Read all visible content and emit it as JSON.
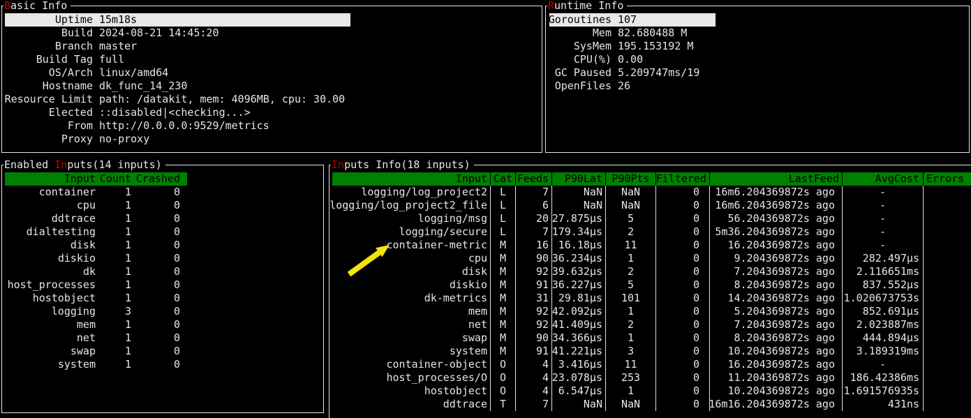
{
  "colors": {
    "background": "#000000",
    "foreground": "#e6e6e6",
    "border": "#e6e6e6",
    "header_green": "#008000",
    "hotkey_red": "#c00000",
    "selection_bg": "#e8e8e8",
    "arrow_yellow": "#f2e40e"
  },
  "panels": {
    "basic_info": {
      "title_segments": [
        {
          "t": "B",
          "red": true
        },
        {
          "t": "asic Info",
          "red": false
        }
      ],
      "rows": [
        {
          "label": "Uptime",
          "value": "15m18s",
          "selected": true
        },
        {
          "label": "Build",
          "value": "2024-08-21 14:45:20"
        },
        {
          "label": "Branch",
          "value": "master"
        },
        {
          "label": "Build Tag",
          "value": "full"
        },
        {
          "label": "OS/Arch",
          "value": "linux/amd64"
        },
        {
          "label": "Hostname",
          "value": "dk_func_14_230"
        },
        {
          "label": "Resource Limit",
          "value": "path: /datakit, mem: 4096MB, cpu: 30.00"
        },
        {
          "label": "Elected",
          "value": "::disabled|<checking...>"
        },
        {
          "label": "From",
          "value": "http://0.0.0.0:9529/metrics"
        },
        {
          "label": "Proxy",
          "value": "no-proxy"
        }
      ]
    },
    "runtime_info": {
      "title_segments": [
        {
          "t": "R",
          "red": true
        },
        {
          "t": "untime Info",
          "red": false
        }
      ],
      "rows": [
        {
          "label": "Goroutines",
          "value": "107",
          "selected": true
        },
        {
          "label": "Mem",
          "value": "82.680488 M"
        },
        {
          "label": "SysMem",
          "value": "195.153192 M"
        },
        {
          "label": "CPU(%)",
          "value": "0.00"
        },
        {
          "label": "GC Paused",
          "value": "5.209747ms/19"
        },
        {
          "label": "OpenFiles",
          "value": "26"
        }
      ]
    },
    "enabled_inputs": {
      "title_segments": [
        {
          "t": "Enabled ",
          "red": false
        },
        {
          "t": "In",
          "red": true
        },
        {
          "t": "puts(14 inputs)",
          "red": false
        }
      ],
      "headers": [
        "Input",
        "Count",
        "Crashed"
      ],
      "rows": [
        [
          "container",
          "1",
          "0"
        ],
        [
          "cpu",
          "1",
          "0"
        ],
        [
          "ddtrace",
          "1",
          "0"
        ],
        [
          "dialtesting",
          "1",
          "0"
        ],
        [
          "disk",
          "1",
          "0"
        ],
        [
          "diskio",
          "1",
          "0"
        ],
        [
          "dk",
          "1",
          "0"
        ],
        [
          "host_processes",
          "1",
          "0"
        ],
        [
          "hostobject",
          "1",
          "0"
        ],
        [
          "logging",
          "3",
          "0"
        ],
        [
          "mem",
          "1",
          "0"
        ],
        [
          "net",
          "1",
          "0"
        ],
        [
          "swap",
          "1",
          "0"
        ],
        [
          "system",
          "1",
          "0"
        ]
      ]
    },
    "inputs_info": {
      "title_segments": [
        {
          "t": "In",
          "red": true
        },
        {
          "t": "puts Info(18 inputs)",
          "red": false
        }
      ],
      "headers": [
        "Input",
        "Cat",
        "Feeds",
        "P90Lat",
        "P90Pts",
        "Filtered",
        "LastFeed",
        "AvgCost",
        "Errors"
      ],
      "rows": [
        [
          "logging/log_project2",
          "L",
          "7",
          "NaN",
          "NaN",
          "0",
          "16m6.204369872s ago",
          "-",
          ""
        ],
        [
          "logging/log_project2_file",
          "L",
          "6",
          "NaN",
          "NaN",
          "0",
          "16m6.204369872s ago",
          "-",
          ""
        ],
        [
          "logging/msg",
          "L",
          "20",
          "27.875µs",
          "5",
          "0",
          "56.204369872s ago",
          "-",
          ""
        ],
        [
          "logging/secure",
          "L",
          "7",
          "179.34µs",
          "2",
          "0",
          "5m36.204369872s ago",
          "-",
          ""
        ],
        [
          "container-metric",
          "M",
          "16",
          "16.18µs",
          "11",
          "0",
          "16.204369872s ago",
          "-",
          ""
        ],
        [
          "cpu",
          "M",
          "90",
          "36.234µs",
          "1",
          "0",
          "9.204369872s ago",
          "282.497µs",
          ""
        ],
        [
          "disk",
          "M",
          "92",
          "39.632µs",
          "2",
          "0",
          "7.204369872s ago",
          "2.116651ms",
          ""
        ],
        [
          "diskio",
          "M",
          "91",
          "36.227µs",
          "5",
          "0",
          "8.204369872s ago",
          "837.552µs",
          ""
        ],
        [
          "dk-metrics",
          "M",
          "31",
          "29.81µs",
          "101",
          "0",
          "14.204369872s ago",
          "1.020673753s",
          ""
        ],
        [
          "mem",
          "M",
          "92",
          "42.092µs",
          "1",
          "0",
          "5.204369872s ago",
          "852.691µs",
          ""
        ],
        [
          "net",
          "M",
          "92",
          "41.409µs",
          "2",
          "0",
          "7.204369872s ago",
          "2.023887ms",
          ""
        ],
        [
          "swap",
          "M",
          "90",
          "34.366µs",
          "1",
          "0",
          "8.204369872s ago",
          "444.894µs",
          ""
        ],
        [
          "system",
          "M",
          "91",
          "41.221µs",
          "3",
          "0",
          "10.204369872s ago",
          "3.189319ms",
          ""
        ],
        [
          "container-object",
          "O",
          "4",
          "3.416µs",
          "11",
          "0",
          "16.204369872s ago",
          "-",
          ""
        ],
        [
          "host_processes/O",
          "O",
          "4",
          "23.078µs",
          "253",
          "0",
          "11.204369872s ago",
          "186.42386ms",
          ""
        ],
        [
          "hostobject",
          "O",
          "4",
          "6.547µs",
          "1",
          "0",
          "10.204369872s ago",
          "1.691576935s",
          ""
        ],
        [
          "ddtrace",
          "T",
          "7",
          "NaN",
          "NaN",
          "0",
          "16m16.204369872s ago",
          "431ns",
          ""
        ]
      ]
    }
  },
  "annotation": {
    "arrow_points_at": "container-metric"
  }
}
